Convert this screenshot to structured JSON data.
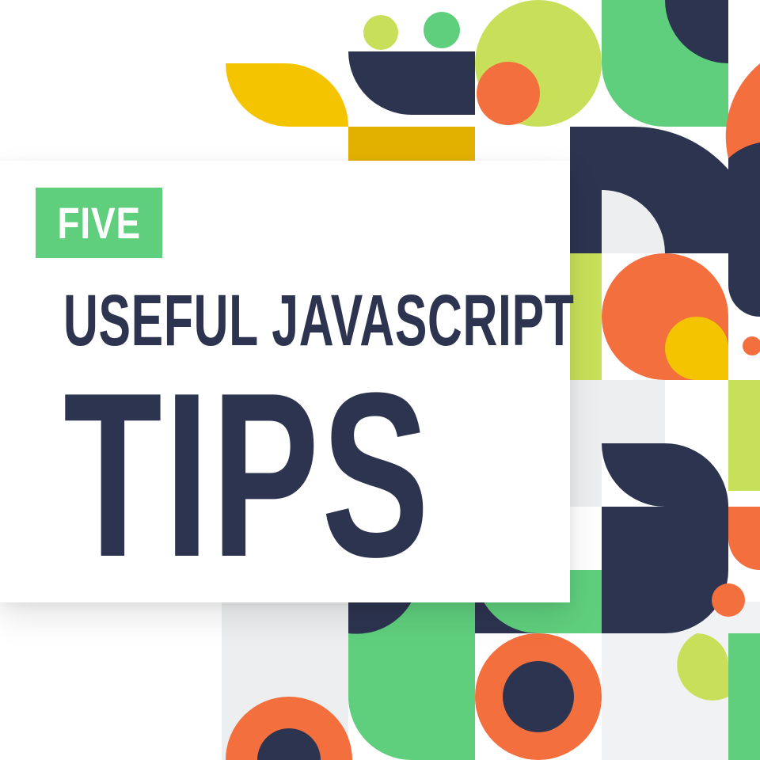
{
  "badge": {
    "label": "FIVE"
  },
  "headline": {
    "subtitle": "USEFUL JAVASCRIPT",
    "title": "TIPS"
  },
  "colors": {
    "navy": "#2d3450",
    "green": "#5fcf7d",
    "lime": "#c8df5a",
    "orange": "#f36f3d",
    "yellow": "#f5c400",
    "light_gray": "#eceeef",
    "white": "#ffffff"
  }
}
